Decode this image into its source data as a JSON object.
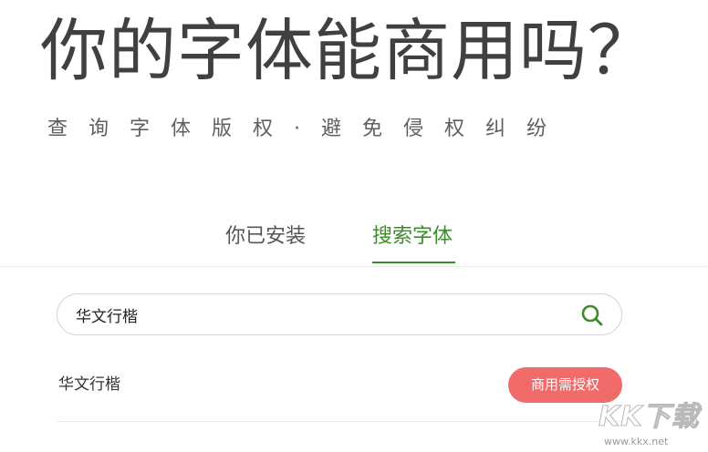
{
  "hero": {
    "title": "你的字体能商用吗？",
    "subtitle": "查询字体版权·避免侵权纠纷"
  },
  "tabs": [
    {
      "label": "你已安装",
      "active": false
    },
    {
      "label": "搜索字体",
      "active": true
    }
  ],
  "search": {
    "value": "华文行楷",
    "icon": "search-icon"
  },
  "results": [
    {
      "name": "华文行楷",
      "badge": "商用需授权"
    }
  ],
  "watermark": {
    "logo": "KK下载",
    "url": "www.kkx.net"
  },
  "colors": {
    "accent": "#3c8c2c",
    "badge": "#f26b6b",
    "title_text": "#404040"
  }
}
